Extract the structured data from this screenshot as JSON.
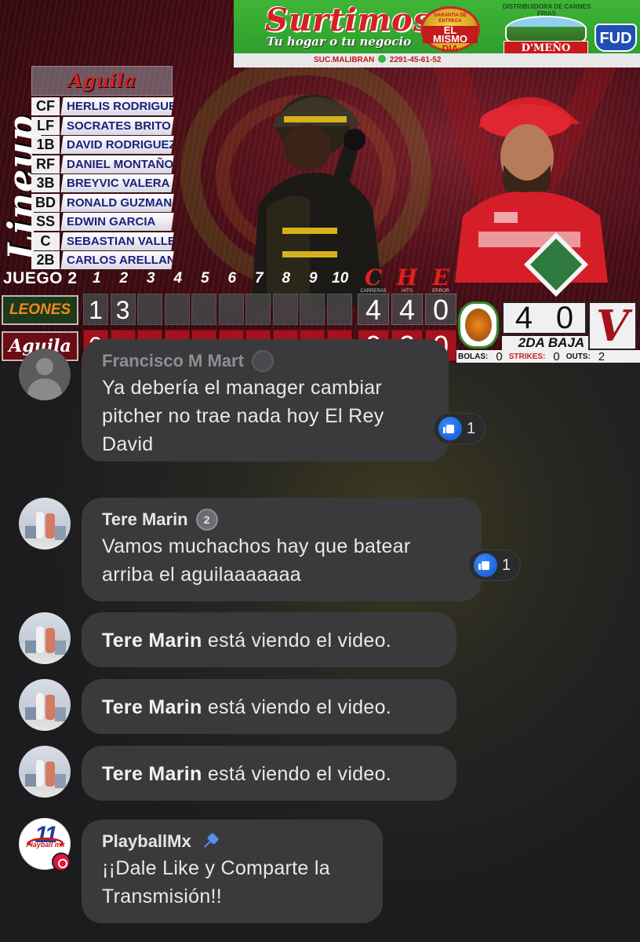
{
  "ad": {
    "title": "Surtimos",
    "subtitle": "Tu hogar o tu negocio",
    "badge_top": "GARANTIA DE ENTREGA",
    "badge_mid": "EL MISMO",
    "badge_bottom": "DIA",
    "branch": "SUC.MALIBRAN",
    "phone": "2291-45-61-52",
    "distributor": "DISTRIBUIDORA DE CARNES FRIAS",
    "brand": "D'MEÑO",
    "fud": "FUD"
  },
  "lineup": {
    "title": "Lineup",
    "team": "Aguila",
    "players": [
      {
        "pos": "CF",
        "name": "HERLIS RODRIGUEZ"
      },
      {
        "pos": "LF",
        "name": "SOCRATES BRITO"
      },
      {
        "pos": "1B",
        "name": "DAVID RODRIGUEZ"
      },
      {
        "pos": "RF",
        "name": "DANIEL MONTAÑO"
      },
      {
        "pos": "3B",
        "name": "BREYVIC VALERA"
      },
      {
        "pos": "BD",
        "name": "RONALD GUZMAN"
      },
      {
        "pos": "SS",
        "name": "EDWIN GARCIA"
      },
      {
        "pos": "C",
        "name": "SEBASTIAN VALLE"
      },
      {
        "pos": "2B",
        "name": "CARLOS ARELLANO"
      }
    ]
  },
  "scoreboard": {
    "game_label": "JUEGO 2",
    "innings": [
      "1",
      "2",
      "3",
      "4",
      "5",
      "6",
      "7",
      "8",
      "9",
      "10"
    ],
    "totals_header": [
      {
        "letter": "C",
        "sub": "CARRERAS"
      },
      {
        "letter": "H",
        "sub": "HITS"
      },
      {
        "letter": "E",
        "sub": "ERROR"
      }
    ],
    "teams": [
      {
        "name": "LEONES",
        "innings": [
          "1",
          "3",
          "",
          "",
          "",
          "",
          "",
          "",
          "",
          ""
        ],
        "totals": [
          "4",
          "4",
          "0"
        ]
      },
      {
        "name": "Aguila",
        "innings": [
          "0",
          "",
          "",
          "",
          "",
          "",
          "",
          "",
          "",
          ""
        ],
        "totals": [
          "0",
          "2",
          "0"
        ]
      }
    ]
  },
  "score_bug": {
    "away_score": "4",
    "home_score": "0",
    "inning": "2DA BAJA",
    "home_logo": "V",
    "balls_label": "BOLAS:",
    "balls": "0",
    "strikes_label": "STRIKES:",
    "strikes": "0",
    "outs_label": "OUTS:",
    "outs": "2"
  },
  "chat": {
    "comments": [
      {
        "name": "Francisco M Mart",
        "badge": "",
        "text": "Ya debería el manager cambiar pitcher no trae nada hoy El Rey David",
        "likes": "1"
      },
      {
        "name": "Tere Marin",
        "badge": "2",
        "text": "Vamos muchachos hay que batear arriba el aguilaaaaaaa",
        "likes": "1"
      },
      {
        "name": "Tere Marin",
        "text": "está viendo el video."
      },
      {
        "name": "Tere Marin",
        "text": "está viendo el video."
      },
      {
        "name": "Tere Marin",
        "text": "está viendo el video."
      },
      {
        "name": "PlayballMx",
        "avatar_text": "11",
        "avatar_word": "Playball mx",
        "text": "¡¡Dale Like y Comparte la Transmisión!!"
      }
    ]
  },
  "colors": {
    "chat_bg": "#1c1c1e",
    "bubble_bg": "#3a3a3c",
    "like_blue": "#1a5fd6",
    "home_red": "#a5121e",
    "ad_green": "#3fb536"
  }
}
